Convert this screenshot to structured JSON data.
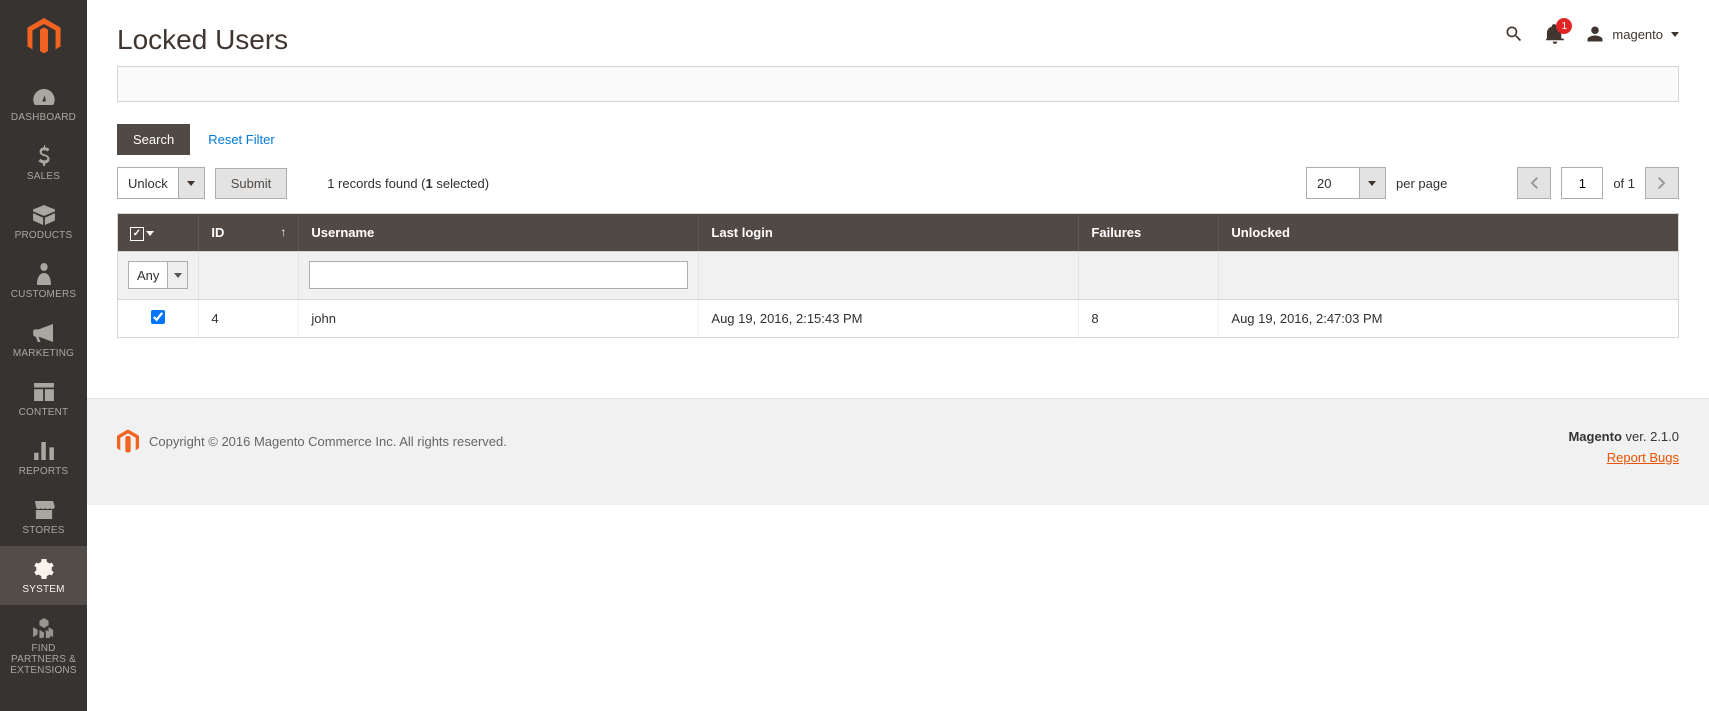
{
  "sidebar": {
    "items": [
      {
        "label": "DASHBOARD"
      },
      {
        "label": "SALES"
      },
      {
        "label": "PRODUCTS"
      },
      {
        "label": "CUSTOMERS"
      },
      {
        "label": "MARKETING"
      },
      {
        "label": "CONTENT"
      },
      {
        "label": "REPORTS"
      },
      {
        "label": "STORES"
      },
      {
        "label": "SYSTEM"
      },
      {
        "label": "FIND PARTNERS & EXTENSIONS"
      }
    ]
  },
  "header": {
    "title": "Locked Users",
    "notification_count": "1",
    "username": "magento"
  },
  "controls": {
    "search_label": "Search",
    "reset_label": "Reset Filter"
  },
  "toolbar": {
    "mass_action": "Unlock",
    "submit_label": "Submit",
    "records_prefix": "1 records found (",
    "records_bold": "1",
    "records_suffix": " selected)",
    "page_size": "20",
    "per_page_label": "per page",
    "page_current": "1",
    "page_of_label": "of 1"
  },
  "table": {
    "headers": {
      "id": "ID",
      "username": "Username",
      "last_login": "Last login",
      "failures": "Failures",
      "unlocked": "Unlocked"
    },
    "filter_any": "Any",
    "row": {
      "id": "4",
      "username": "john",
      "last_login": "Aug 19, 2016, 2:15:43 PM",
      "failures": "8",
      "unlocked": "Aug 19, 2016, 2:47:03 PM"
    }
  },
  "footer": {
    "copyright": "Copyright © 2016 Magento Commerce Inc. All rights reserved.",
    "version_prefix": "Magento",
    "version_suffix": " ver. 2.1.0",
    "report_bugs": "Report Bugs"
  }
}
